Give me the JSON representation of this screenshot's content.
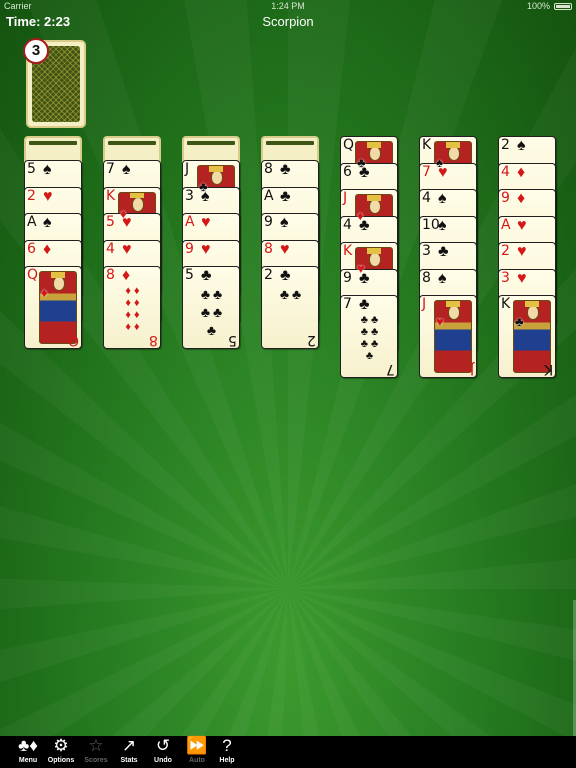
{
  "status": {
    "carrier": "Carrier",
    "time": "1:24 PM",
    "battery": "100%"
  },
  "header": {
    "time_label": "Time: 2:23",
    "title": "Scorpion"
  },
  "stock": {
    "count": "3"
  },
  "piles": [
    {
      "facedown": 1,
      "cards": [
        {
          "rank": "5",
          "suit": "♠",
          "color": "black"
        },
        {
          "rank": "2",
          "suit": "♥",
          "color": "red"
        },
        {
          "rank": "A",
          "suit": "♠",
          "color": "black"
        },
        {
          "rank": "6",
          "suit": "♦",
          "color": "red"
        },
        {
          "rank": "Q",
          "suit": "♦",
          "color": "red",
          "face": true
        }
      ]
    },
    {
      "facedown": 1,
      "cards": [
        {
          "rank": "7",
          "suit": "♠",
          "color": "black"
        },
        {
          "rank": "K",
          "suit": "♦",
          "color": "red",
          "face": true
        },
        {
          "rank": "5",
          "suit": "♥",
          "color": "red"
        },
        {
          "rank": "4",
          "suit": "♥",
          "color": "red"
        },
        {
          "rank": "8",
          "suit": "♦",
          "color": "red"
        }
      ]
    },
    {
      "facedown": 1,
      "cards": [
        {
          "rank": "J",
          "suit": "♣",
          "color": "black",
          "face": true
        },
        {
          "rank": "3",
          "suit": "♠",
          "color": "black"
        },
        {
          "rank": "A",
          "suit": "♥",
          "color": "red"
        },
        {
          "rank": "9",
          "suit": "♥",
          "color": "red"
        },
        {
          "rank": "5",
          "suit": "♣",
          "color": "black"
        }
      ]
    },
    {
      "facedown": 1,
      "cards": [
        {
          "rank": "8",
          "suit": "♣",
          "color": "black"
        },
        {
          "rank": "A",
          "suit": "♣",
          "color": "black"
        },
        {
          "rank": "9",
          "suit": "♠",
          "color": "black"
        },
        {
          "rank": "8",
          "suit": "♥",
          "color": "red"
        },
        {
          "rank": "2",
          "suit": "♣",
          "color": "black"
        }
      ]
    },
    {
      "facedown": 0,
      "cards": [
        {
          "rank": "Q",
          "suit": "♣",
          "color": "black",
          "face": true
        },
        {
          "rank": "6",
          "suit": "♣",
          "color": "black"
        },
        {
          "rank": "J",
          "suit": "♦",
          "color": "red",
          "face": true
        },
        {
          "rank": "4",
          "suit": "♣",
          "color": "black"
        },
        {
          "rank": "K",
          "suit": "♥",
          "color": "red",
          "face": true
        },
        {
          "rank": "9",
          "suit": "♣",
          "color": "black"
        },
        {
          "rank": "7",
          "suit": "♣",
          "color": "black"
        }
      ]
    },
    {
      "facedown": 0,
      "cards": [
        {
          "rank": "K",
          "suit": "♠",
          "color": "black",
          "face": true
        },
        {
          "rank": "7",
          "suit": "♥",
          "color": "red"
        },
        {
          "rank": "4",
          "suit": "♠",
          "color": "black"
        },
        {
          "rank": "10",
          "suit": "♠",
          "color": "black"
        },
        {
          "rank": "3",
          "suit": "♣",
          "color": "black"
        },
        {
          "rank": "8",
          "suit": "♠",
          "color": "black"
        },
        {
          "rank": "J",
          "suit": "♥",
          "color": "red",
          "face": true
        }
      ]
    },
    {
      "facedown": 0,
      "cards": [
        {
          "rank": "2",
          "suit": "♠",
          "color": "black"
        },
        {
          "rank": "4",
          "suit": "♦",
          "color": "red"
        },
        {
          "rank": "9",
          "suit": "♦",
          "color": "red"
        },
        {
          "rank": "A",
          "suit": "♥",
          "color": "red"
        },
        {
          "rank": "2",
          "suit": "♥",
          "color": "red"
        },
        {
          "rank": "3",
          "suit": "♥",
          "color": "red"
        },
        {
          "rank": "K",
          "suit": "♣",
          "color": "black",
          "face": true
        }
      ]
    }
  ],
  "toolbar": [
    {
      "id": "menu",
      "label": "Menu",
      "icon": "♣♦",
      "enabled": true
    },
    {
      "id": "options",
      "label": "Options",
      "icon": "⚙",
      "enabled": true
    },
    {
      "id": "scores",
      "label": "Scores",
      "icon": "☆",
      "enabled": false
    },
    {
      "id": "stats",
      "label": "Stats",
      "icon": "↗",
      "enabled": true
    },
    {
      "id": "undo",
      "label": "Undo",
      "icon": "↺",
      "enabled": true
    },
    {
      "id": "auto",
      "label": "Auto",
      "icon": "⏩",
      "enabled": false
    },
    {
      "id": "help",
      "label": "Help",
      "icon": "?",
      "enabled": true
    }
  ]
}
